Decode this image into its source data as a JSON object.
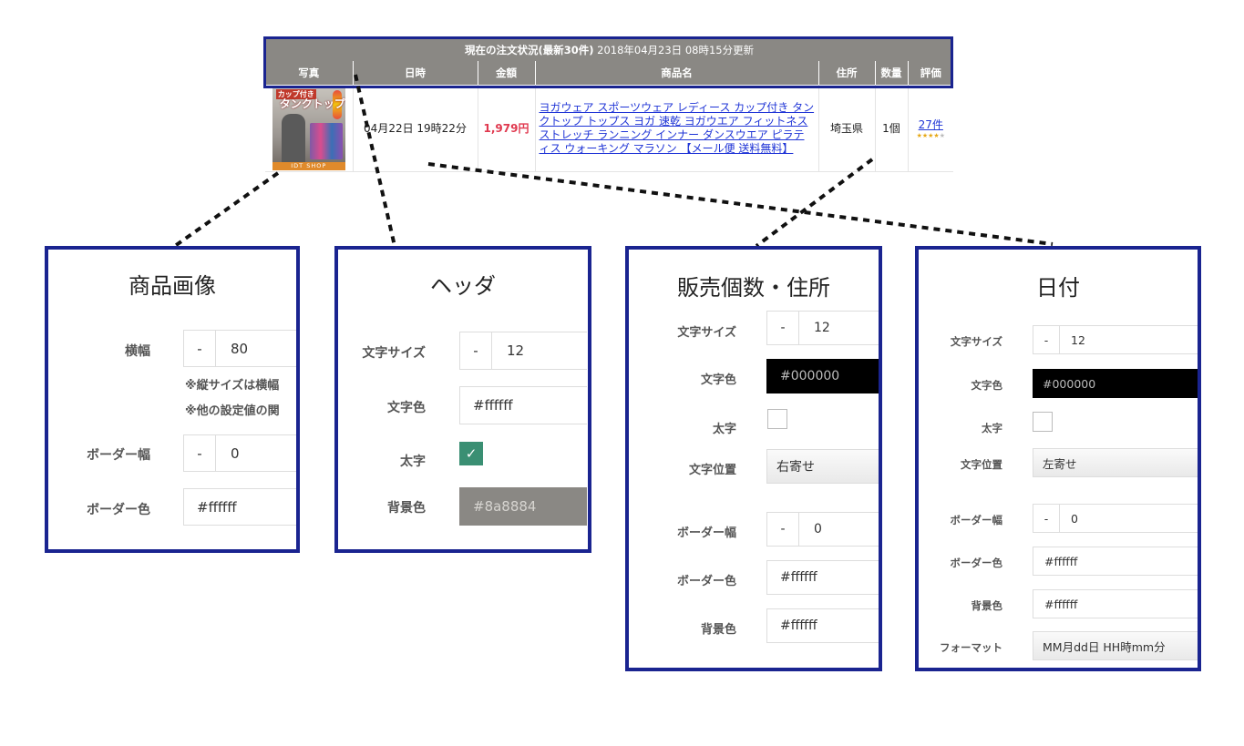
{
  "order_table": {
    "title_bold": "現在の注文状況(最新30件)",
    "title_rest": " 2018年04月23日 08時15分更新",
    "headers": [
      "写真",
      "日時",
      "金額",
      "商品名",
      "住所",
      "数量",
      "評価"
    ],
    "row": {
      "image_text_top": "カップ付き",
      "image_text_main": "タンクトップ",
      "image_shop": "IDT SHOP",
      "date": "04月22日 19時22分",
      "price": "1,979円",
      "product": "ヨガウェア スポーツウェア レディース カップ付き タンクトップ トップス ヨガ 速乾 ヨガウエア フィットネス ストレッチ ランニング インナー ダンスウエア ピラティス ウォーキング マラソン 【メール便 送料無料】",
      "address": "埼玉県",
      "quantity": "1個",
      "reviews": "27件",
      "stars_on": "★★★★",
      "stars_off": "★"
    }
  },
  "panels": {
    "image": {
      "title": "商品画像",
      "width_label": "横幅",
      "width_value": "80",
      "note1": "※縦サイズは横幅",
      "note2": "※他の設定値の関",
      "border_width_label": "ボーダー幅",
      "border_width_value": "0",
      "border_color_label": "ボーダー色",
      "border_color_value": "#ffffff"
    },
    "header": {
      "title": "ヘッダ",
      "font_size_label": "文字サイズ",
      "font_size_value": "12",
      "font_color_label": "文字色",
      "font_color_value": "#ffffff",
      "bold_label": "太字",
      "bold_checked": true,
      "bg_label": "背景色",
      "bg_value": "#8a8884"
    },
    "quantity": {
      "title": "販売個数・住所",
      "font_size_label": "文字サイズ",
      "font_size_value": "12",
      "font_color_label": "文字色",
      "font_color_value": "#000000",
      "bold_label": "太字",
      "align_label": "文字位置",
      "align_value": "右寄せ",
      "border_width_label": "ボーダー幅",
      "border_width_value": "0",
      "border_color_label": "ボーダー色",
      "border_color_value": "#ffffff",
      "bg_label": "背景色",
      "bg_value": "#ffffff"
    },
    "date": {
      "title": "日付",
      "font_size_label": "文字サイズ",
      "font_size_value": "12",
      "font_color_label": "文字色",
      "font_color_value": "#000000",
      "bold_label": "太字",
      "align_label": "文字位置",
      "align_value": "左寄せ",
      "border_width_label": "ボーダー幅",
      "border_width_value": "0",
      "border_color_label": "ボーダー色",
      "border_color_value": "#ffffff",
      "bg_label": "背景色",
      "bg_value": "#ffffff",
      "format_label": "フォーマット",
      "format_value": "MM月dd日 HH時mm分"
    }
  },
  "stepper_minus": "-",
  "checkmark": "✓",
  "colors": {
    "frame": "#1a2490",
    "header_bg": "#8a8884",
    "price": "#e0394f",
    "link": "#1f34d6",
    "check": "#3a8f73"
  }
}
